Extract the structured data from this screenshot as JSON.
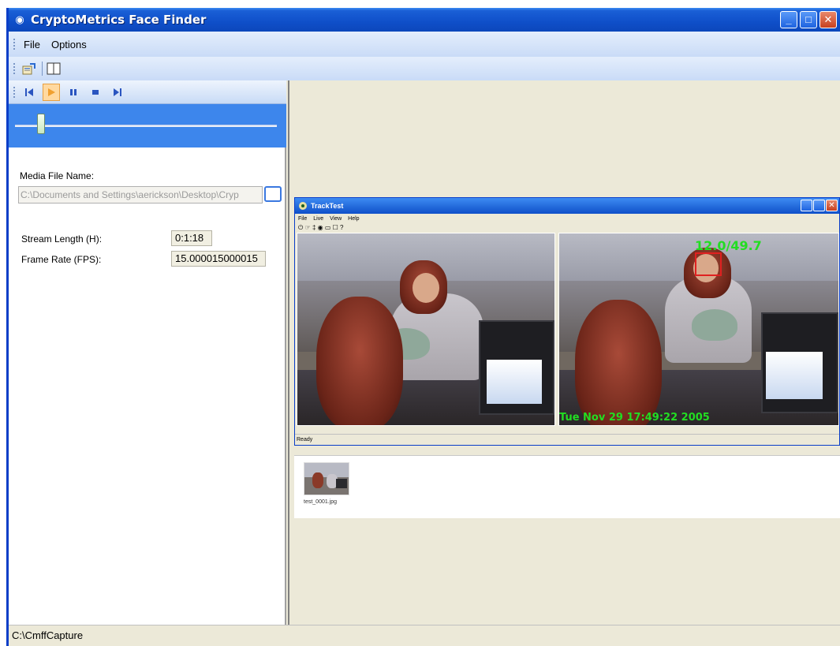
{
  "window": {
    "title": "CryptoMetrics Face Finder",
    "min_label": "_",
    "max_label": "□",
    "close_label": "✕"
  },
  "menu": {
    "items": [
      "File",
      "Options"
    ]
  },
  "toolbar": {
    "icons": [
      "properties-icon",
      "layout-icon"
    ]
  },
  "media_controls": {
    "icons": [
      "skip-back-icon",
      "play-icon",
      "pause-icon",
      "stop-icon",
      "skip-forward-icon"
    ],
    "slider_position": 0.1
  },
  "media": {
    "file_label": "Media File Name:",
    "file_value": "C:\\Documents and Settings\\aerickson\\Desktop\\Cryp",
    "stream_length_label": "Stream Length (H):",
    "stream_length_value": "0:1:18",
    "frame_rate_label": "Frame Rate (FPS):",
    "frame_rate_value": "15.000015000015"
  },
  "track_window": {
    "title": "TrackTest",
    "menu": [
      "File",
      "Live",
      "View",
      "Help"
    ],
    "tools": "⏻ ☞ ‡ ◉ ▭ ☐ ?",
    "overlay_ratio": "12.0/49.7",
    "overlay_timestamp": "Tue Nov 29 17:49:22 2005",
    "status": "Ready"
  },
  "capture": {
    "thumb_label": "test_0001.jpg"
  },
  "statusbar": {
    "text": "C:\\CmffCapture"
  }
}
